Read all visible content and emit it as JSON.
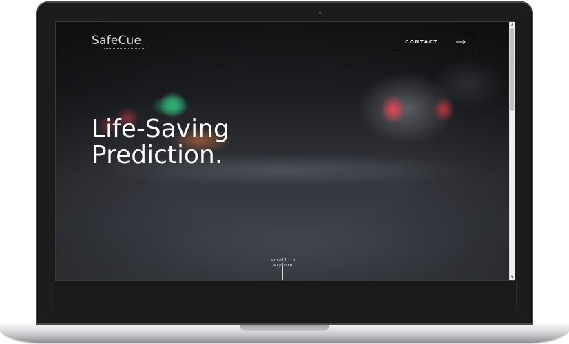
{
  "brand": {
    "name": "SafeCue"
  },
  "header": {
    "contact_label": "CONTACT"
  },
  "hero": {
    "headline_line1": "Life-Saving",
    "headline_line2": "Prediction."
  },
  "scroll_hint": {
    "label": "scroll to explore"
  },
  "icons": {
    "contact_arrow": "arrow-right-icon",
    "scroll_up": "scroll-up-arrow-icon",
    "scroll_down": "scroll-down-arrow-icon",
    "camera": "webcam-icon"
  },
  "colors": {
    "laptop_bezel": "#1c1c1d",
    "screen_background": "#2a2c30",
    "text_primary": "#ffffff",
    "button_border": "#cfd0d2",
    "scrollbar_track": "#f1f1f1",
    "scrollbar_thumb": "#c1c1c1"
  }
}
